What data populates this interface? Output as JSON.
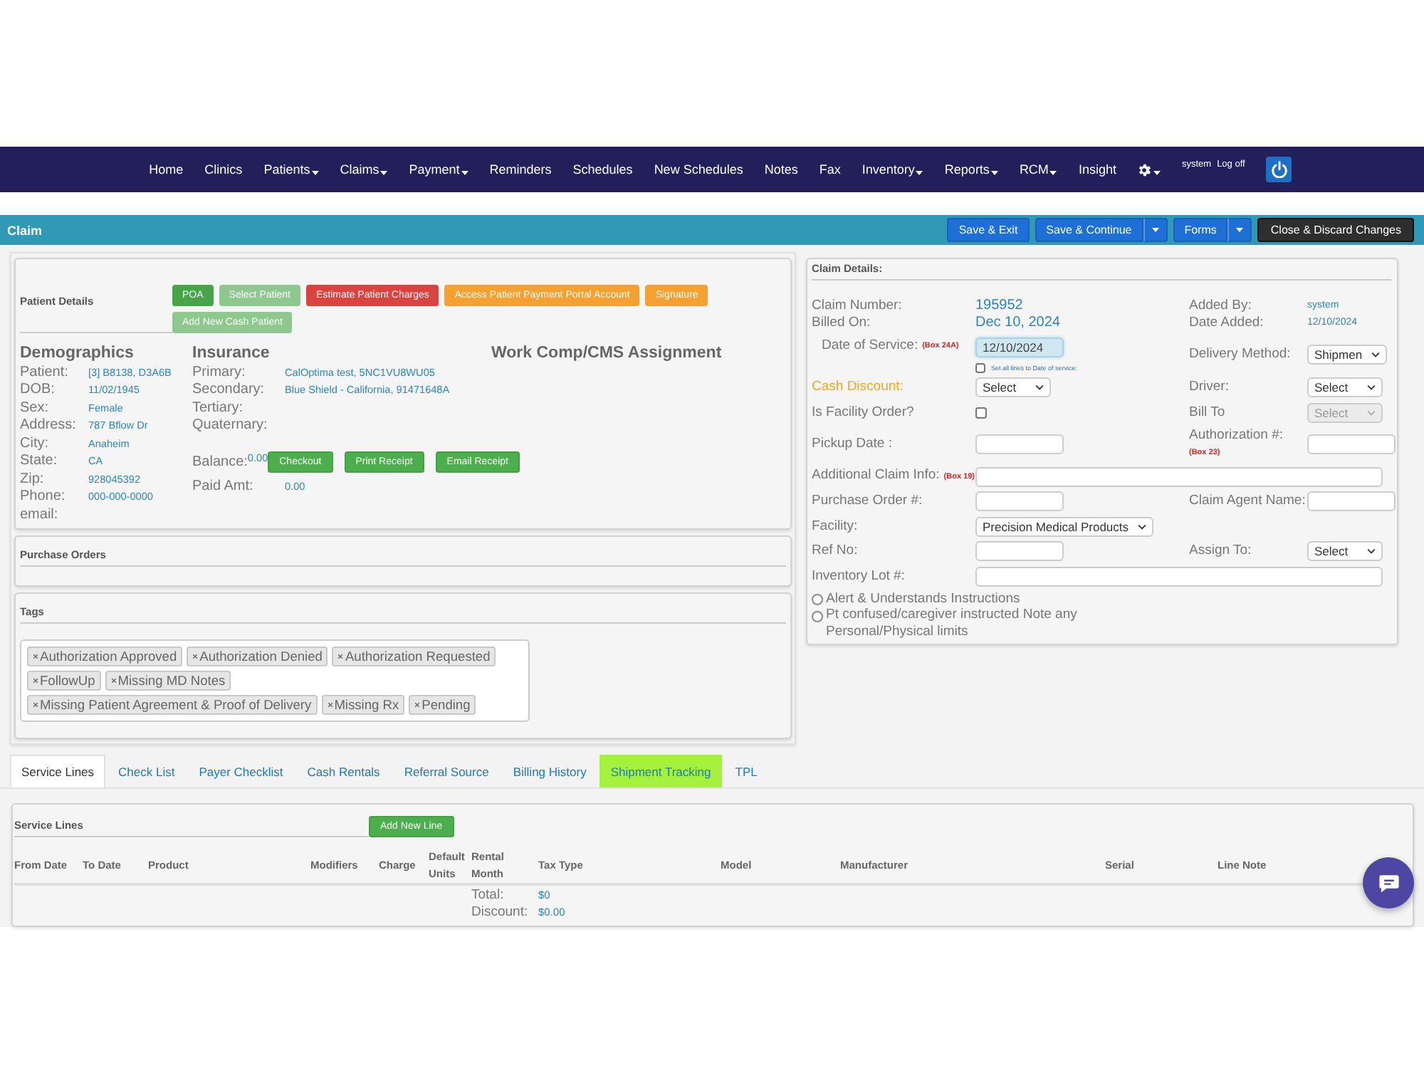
{
  "nav": {
    "items": [
      {
        "label": "Home",
        "dropdown": false
      },
      {
        "label": "Clinics",
        "dropdown": false
      },
      {
        "label": "Patients",
        "dropdown": true
      },
      {
        "label": "Claims",
        "dropdown": true
      },
      {
        "label": "Payment",
        "dropdown": true
      },
      {
        "label": "Reminders",
        "dropdown": false
      },
      {
        "label": "Schedules",
        "dropdown": false
      },
      {
        "label": "New Schedules",
        "dropdown": false
      },
      {
        "label": "Notes",
        "dropdown": false
      },
      {
        "label": "Fax",
        "dropdown": false
      },
      {
        "label": "Inventory",
        "dropdown": true
      },
      {
        "label": "Reports",
        "dropdown": true
      },
      {
        "label": "RCM",
        "dropdown": true
      },
      {
        "label": "Insight",
        "dropdown": false
      }
    ],
    "settings_dropdown": true,
    "user": "system",
    "logoff": "Log off"
  },
  "claim_bar": {
    "title": "Claim",
    "buttons": [
      {
        "label": "Save & Exit",
        "kind": "primary",
        "split": false
      },
      {
        "label": "Save & Continue",
        "kind": "primary",
        "split": true
      },
      {
        "label": "Forms",
        "kind": "primary",
        "split": true
      },
      {
        "label": "Close & Discard Changes",
        "kind": "dark",
        "split": false
      }
    ]
  },
  "patient_details": {
    "title": "Patient Details",
    "buttons": [
      {
        "label": "POA",
        "color": "#47a447"
      },
      {
        "label": "Select Patient",
        "color": "#8ec88e"
      },
      {
        "label": "Estimate Patient Charges",
        "color": "#d9443f"
      },
      {
        "label": "Access Patient Payment Portal Account",
        "color": "#f5a132"
      },
      {
        "label": "Signature",
        "color": "#f5a132"
      },
      {
        "label": "Add New Cash Patient",
        "color": "#8ec88e"
      }
    ],
    "demographics": {
      "title": "Demographics",
      "fields": [
        {
          "label": "Patient:",
          "value": "[3] B8138, D3A6B"
        },
        {
          "label": "DOB:",
          "value": "11/02/1945"
        },
        {
          "label": "Sex:",
          "value": "Female"
        },
        {
          "label": "Address:",
          "value": "787 Bflow Dr"
        },
        {
          "label": "City:",
          "value": "Anaheim"
        },
        {
          "label": "State:",
          "value": "CA"
        },
        {
          "label": "Zip:",
          "value": "928045392"
        },
        {
          "label": "Phone:",
          "value": "000-000-0000"
        },
        {
          "label": "email:"
        }
      ]
    },
    "insurance": {
      "title": "Insurance",
      "fields": [
        {
          "label": "Primary:",
          "value": "CalOptima test, 5NC1VU8WU05"
        },
        {
          "label": "Secondary:",
          "value": "Blue Shield - California, 91471648A"
        },
        {
          "label": "Tertiary:"
        },
        {
          "label": "Quaternary:"
        }
      ],
      "balance": {
        "label": "Balance:",
        "value": "0.00"
      },
      "paid": {
        "label": "Paid Amt:",
        "value": "0.00"
      },
      "buttons": [
        "Checkout",
        "Print Receipt",
        "Email Receipt"
      ]
    },
    "work_comp": {
      "title": "Work Comp/CMS Assignment"
    }
  },
  "claim_details": {
    "title": "Claim Details:",
    "rows": [
      [
        {
          "kind": "value",
          "label": "Claim Number:",
          "value": "195952"
        },
        {
          "kind": "value",
          "label": "Added By:",
          "value": "system"
        }
      ],
      [
        {
          "kind": "value",
          "label": "Billed On:",
          "value": "Dec 10, 2024"
        },
        {
          "kind": "value",
          "label": "Date Added:",
          "value": "12/10/2024"
        }
      ],
      [
        {
          "kind": "date",
          "label": "Date of Service:",
          "note": "(Box 24A)",
          "value": "12/10/2024",
          "option": {
            "label": "Set all lines to Date of service:",
            "checked": false
          }
        },
        {
          "kind": "select",
          "label": "Delivery Method:",
          "value": "Shipmen",
          "disabled": false
        }
      ],
      [
        {
          "kind": "select",
          "label": "Cash Discount:",
          "value": "Select",
          "disabled": false,
          "color": "#f5a623"
        },
        {
          "kind": "select",
          "label": "Driver:",
          "value": "Select",
          "disabled": false
        }
      ],
      [
        {
          "kind": "checkbox",
          "label": "Is Facility Order?",
          "checked": false
        },
        {
          "kind": "select",
          "label": "Bill To",
          "value": "Select",
          "disabled": true
        }
      ],
      [
        {
          "kind": "input",
          "label": "Pickup Date :"
        },
        {
          "kind": "input",
          "label": "Authorization #:",
          "note": "(Box 23)"
        }
      ],
      [
        {
          "kind": "wide_input",
          "label": "Additional Claim Info:",
          "note": "(Box 19)"
        }
      ],
      [
        {
          "kind": "input",
          "label": "Purchase Order #:"
        },
        {
          "kind": "input",
          "label": "Claim Agent Name:"
        }
      ],
      [
        {
          "kind": "select",
          "label": "Facility:",
          "value": "Precision Medical Products",
          "disabled": false
        }
      ],
      [
        {
          "kind": "input",
          "label": "Ref No:"
        },
        {
          "kind": "select",
          "label": "Assign To:",
          "value": "Select",
          "disabled": false
        }
      ],
      [
        {
          "kind": "wide_input",
          "label": "Inventory Lot #:"
        }
      ]
    ],
    "radios": [
      {
        "label": "Alert & Understands Instructions",
        "selected": false
      },
      {
        "label": "Pt confused/caregiver instructed Note any Personal/Physical limits",
        "selected": false
      }
    ]
  },
  "purchase_orders": {
    "title": "Purchase Orders"
  },
  "tags": {
    "title": "Tags",
    "items": [
      "Authorization Approved",
      "Authorization Denied",
      "Authorization Requested",
      "FollowUp",
      "Missing MD Notes",
      "Missing Patient Agreement & Proof of Delivery",
      "Missing Rx",
      "Pending"
    ]
  },
  "tabs": [
    {
      "label": "Service Lines",
      "selected": true,
      "highlighted": false
    },
    {
      "label": "Check List",
      "selected": false,
      "highlighted": false
    },
    {
      "label": "Payer Checklist",
      "selected": false,
      "highlighted": false
    },
    {
      "label": "Cash Rentals",
      "selected": false,
      "highlighted": false
    },
    {
      "label": "Referral Source",
      "selected": false,
      "highlighted": false
    },
    {
      "label": "Billing History",
      "selected": false,
      "highlighted": false
    },
    {
      "label": "Shipment Tracking",
      "selected": false,
      "highlighted": true
    },
    {
      "label": "TPL",
      "selected": false,
      "highlighted": false
    }
  ],
  "service_lines": {
    "title": "Service Lines",
    "add_button": "Add New Line",
    "columns": [
      "From Date",
      "To Date",
      "Product",
      "Modifiers",
      "Charge",
      "Default Units",
      "Rental Month",
      "Tax Type",
      "Model",
      "Manufacturer",
      "Serial",
      "Line Note"
    ],
    "totals": [
      {
        "label": "Total:",
        "value": "$0"
      },
      {
        "label": "Discount:",
        "value": "$0.00"
      }
    ]
  }
}
